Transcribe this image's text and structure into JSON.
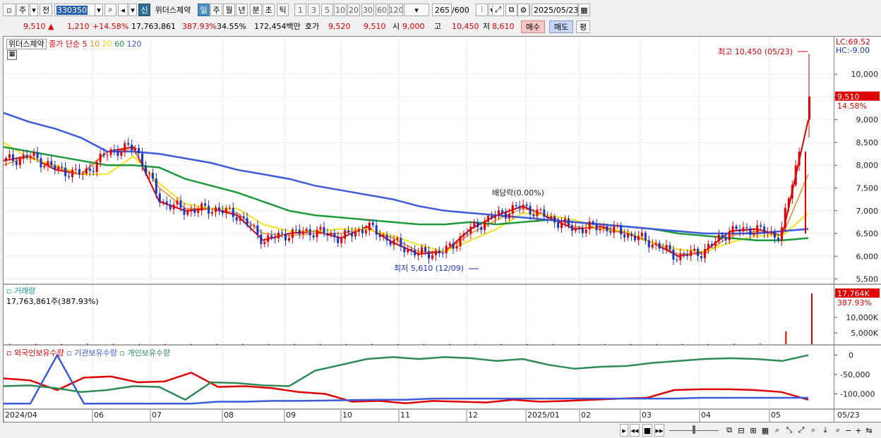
{
  "toolbar": {
    "market": "주",
    "prev": "전",
    "code": "330350",
    "shin": "신",
    "name": "위더스제약",
    "periods": [
      "일",
      "주",
      "월",
      "년",
      "분",
      "초",
      "틱"
    ],
    "intervals": [
      "1",
      "3",
      "5",
      "10",
      "20",
      "30",
      "60",
      "120"
    ],
    "count": "265",
    "count_total": "/600",
    "date": "2025/05/23"
  },
  "quote": {
    "price": "9,510",
    "change": "1,210",
    "change_pct": "+14.58%",
    "volume": "17,763,861",
    "vol_ratio": "387.93%",
    "turnover": "34.55%",
    "amount": "172,454백만",
    "hoga_label": "호가",
    "hoga_bid": "9,520",
    "hoga_ask": "9,510",
    "open_label": "시",
    "open": "9,000",
    "high_label": "고",
    "high": "10,450",
    "low_label": "저",
    "low": "8,610",
    "buy": "매수",
    "sell": "매도",
    "pyeong": "평"
  },
  "legend": {
    "name": "위더스제약",
    "close_label": "종가 단순",
    "ma": [
      "5",
      "10",
      "20",
      "60",
      "120"
    ]
  },
  "labels": {
    "high_note": "최고 10,450 (05/23)",
    "low_note": "최저 5,610 (12/09)",
    "dividend": "배당락(0.00%)",
    "lc": "LC:69.52",
    "hc": "HC:-9.00",
    "volume_title": "거래량",
    "volume_value": "17,763,861주(387.93%)",
    "holdings": [
      "외국인보유수량",
      "기관보유수량",
      "개인보유수량"
    ]
  },
  "colors": {
    "up": "#e00000",
    "down": "#1a33c8",
    "ma5": "#e00000",
    "ma10": "#f08a1e",
    "ma20": "#f5e21c",
    "ma60": "#1e9a3c",
    "ma120": "#3b5bdb",
    "foreign": "#e00000",
    "institution": "#3b5bdb",
    "individual": "#2e8b57"
  },
  "chart_data": [
    {
      "type": "line",
      "title": "위더스제약",
      "x": [
        "2024/04",
        "06",
        "07",
        "08",
        "09",
        "10",
        "11",
        "12",
        "2025/01",
        "02",
        "03",
        "04",
        "05",
        "05/23"
      ],
      "ylim": [
        5400,
        10700
      ],
      "y_ticks": [
        "10,000",
        "9,500",
        "9,000",
        "8,500",
        "8,000",
        "7,500",
        "7,000",
        "6,500",
        "6,000",
        "5,500"
      ],
      "last_price": "9,510",
      "last_pct": "14.58%",
      "series": [
        {
          "name": "5",
          "values": [
            8100,
            8200,
            7900,
            7800,
            8300,
            8400,
            7200,
            7000,
            7050,
            6900,
            6350,
            6500,
            6550,
            6400,
            6650,
            6300,
            6050,
            6100,
            6600,
            6900,
            7100,
            6850,
            6600,
            6650,
            6500,
            6300,
            6000,
            6100,
            6550,
            6600,
            6450,
            9000
          ]
        },
        {
          "name": "10",
          "values": [
            8000,
            8200,
            7950,
            7800,
            8300,
            8350,
            7500,
            7050,
            7050,
            6950,
            6500,
            6450,
            6500,
            6500,
            6600,
            6400,
            6100,
            6100,
            6500,
            6800,
            7050,
            6900,
            6650,
            6600,
            6500,
            6300,
            6050,
            6050,
            6450,
            6550,
            6450,
            7800
          ]
        },
        {
          "name": "20",
          "values": [
            8500,
            8150,
            8000,
            7800,
            7800,
            8200,
            7600,
            7150,
            7050,
            7050,
            6700,
            6550,
            6550,
            6600,
            6600,
            6450,
            6250,
            6100,
            6350,
            6600,
            6950,
            6900,
            6800,
            6600,
            6550,
            6300,
            6150,
            6100,
            6300,
            6450,
            6450,
            6950
          ]
        },
        {
          "name": "60",
          "values": [
            8400,
            8300,
            8200,
            8100,
            8000,
            8000,
            7950,
            7700,
            7550,
            7400,
            7200,
            7000,
            6900,
            6850,
            6800,
            6750,
            6700,
            6700,
            6750,
            6700,
            6750,
            6800,
            6750,
            6700,
            6650,
            6600,
            6500,
            6450,
            6400,
            6350,
            6350,
            6400
          ]
        },
        {
          "name": "120",
          "values": [
            9150,
            8950,
            8800,
            8600,
            8300,
            8300,
            8250,
            8150,
            8050,
            7900,
            7800,
            7700,
            7550,
            7450,
            7350,
            7250,
            7100,
            7000,
            6950,
            6900,
            6850,
            6800,
            6750,
            6700,
            6650,
            6600,
            6550,
            6500,
            6500,
            6500,
            6550,
            6600
          ]
        }
      ]
    },
    {
      "type": "bar",
      "title": "거래량",
      "ytick_labels": [
        "17,764K",
        "10,000K",
        "5,000K"
      ],
      "volume_pct": "387.93%",
      "values_k": [
        100,
        120,
        90,
        150,
        110,
        80,
        60,
        70,
        90,
        100,
        60,
        80,
        70,
        60,
        90,
        60,
        70,
        50,
        60,
        80,
        70,
        60,
        50,
        60,
        80,
        70,
        90,
        60,
        120,
        200,
        4500,
        17764
      ]
    },
    {
      "type": "line",
      "title": "보유수량",
      "y_ticks": [
        "0",
        "-50,000",
        "-100,000"
      ],
      "series": [
        {
          "name": "외국인보유수량",
          "values": [
            -60000,
            -65000,
            -90000,
            -58000,
            -55000,
            -70000,
            -68000,
            -45000,
            -82000,
            -80000,
            -85000,
            -95000,
            -100000,
            -120000,
            -118000,
            -124000,
            -118000,
            -120000,
            -122000,
            -115000,
            -120000,
            -118000,
            -115000,
            -112000,
            -110000,
            -90000,
            -88000,
            -88000,
            -90000,
            -95000,
            -115000
          ]
        },
        {
          "name": "기관보유수량",
          "values": [
            -125000,
            -125000,
            0,
            -125000,
            -125000,
            -125000,
            -125000,
            -125000,
            -120000,
            -120000,
            -118000,
            -118000,
            -117000,
            -116000,
            -115000,
            -115000,
            -112000,
            -112000,
            -112000,
            -112000,
            -112000,
            -112000,
            -112000,
            -112000,
            -112000,
            -112000,
            -110000,
            -110000,
            -110000,
            -110000,
            -110000
          ]
        },
        {
          "name": "개인보유수량",
          "values": [
            -80000,
            -78000,
            -85000,
            -95000,
            -90000,
            -80000,
            -82000,
            -115000,
            -70000,
            -72000,
            -78000,
            -80000,
            -40000,
            -25000,
            -10000,
            -5000,
            -10000,
            -5000,
            -8000,
            -15000,
            -10000,
            -25000,
            -35000,
            -30000,
            -28000,
            -20000,
            -15000,
            -10000,
            -8000,
            -10000,
            -15000,
            0
          ]
        }
      ]
    }
  ]
}
